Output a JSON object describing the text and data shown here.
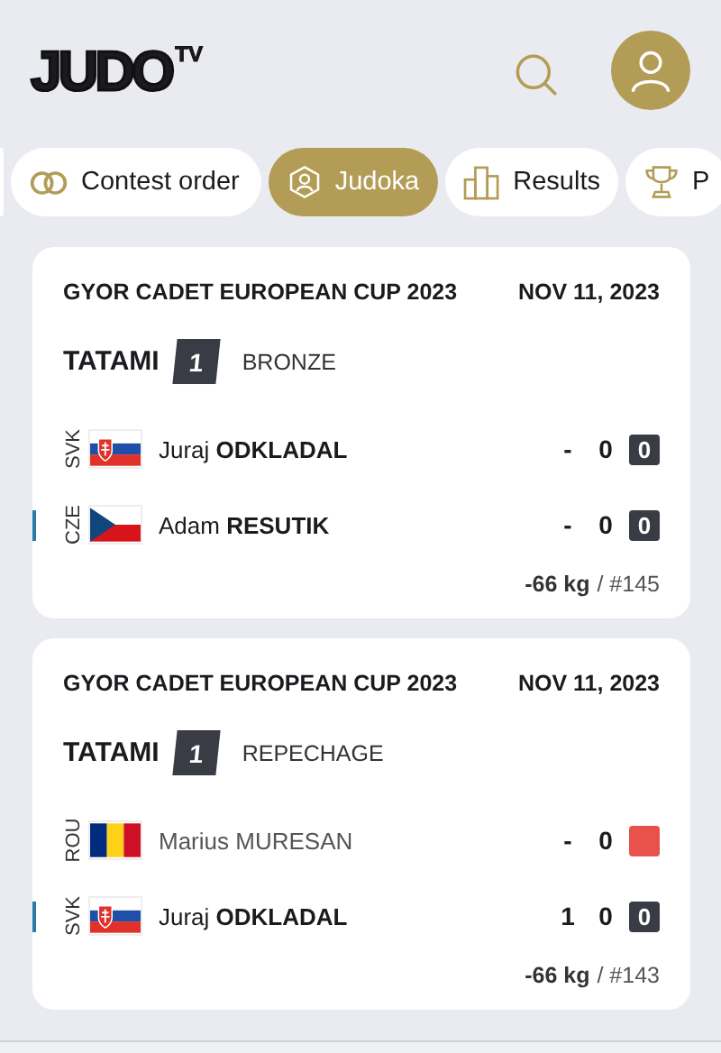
{
  "logo": {
    "text": "JUDO",
    "superscript": "TV"
  },
  "tabs": [
    {
      "label": "Contest order",
      "selected": false
    },
    {
      "label": "Judoka",
      "selected": true
    },
    {
      "label": "Results",
      "selected": false
    },
    {
      "label": "P",
      "selected": false
    }
  ],
  "contests": [
    {
      "event": "GYOR CADET EUROPEAN CUP 2023",
      "date": "NOV 11, 2023",
      "tatami_label": "TATAMI",
      "tatami": "1",
      "round": "BRONZE",
      "weight": "-66 kg",
      "number": "/ #145",
      "competitors": [
        {
          "country": "SVK",
          "first_name": "Juraj",
          "last_name": "ODKLADAL",
          "dimmed": false,
          "marked": false,
          "score_1": "-",
          "score_2": "0",
          "penalty": {
            "kind": "count",
            "text": "0"
          }
        },
        {
          "country": "CZE",
          "first_name": "Adam",
          "last_name": "RESUTIK",
          "dimmed": false,
          "marked": true,
          "score_1": "-",
          "score_2": "0",
          "penalty": {
            "kind": "count",
            "text": "0"
          }
        }
      ]
    },
    {
      "event": "GYOR CADET EUROPEAN CUP 2023",
      "date": "NOV 11, 2023",
      "tatami_label": "TATAMI",
      "tatami": "1",
      "round": "REPECHAGE",
      "weight": "-66 kg",
      "number": "/ #143",
      "competitors": [
        {
          "country": "ROU",
          "first_name": "Marius",
          "last_name": "MURESAN",
          "dimmed": true,
          "marked": false,
          "score_1": "-",
          "score_2": "0",
          "penalty": {
            "kind": "red"
          }
        },
        {
          "country": "SVK",
          "first_name": "Juraj",
          "last_name": "ODKLADAL",
          "dimmed": false,
          "marked": true,
          "score_1": "1",
          "score_2": "0",
          "penalty": {
            "kind": "count",
            "text": "0"
          }
        }
      ]
    }
  ]
}
